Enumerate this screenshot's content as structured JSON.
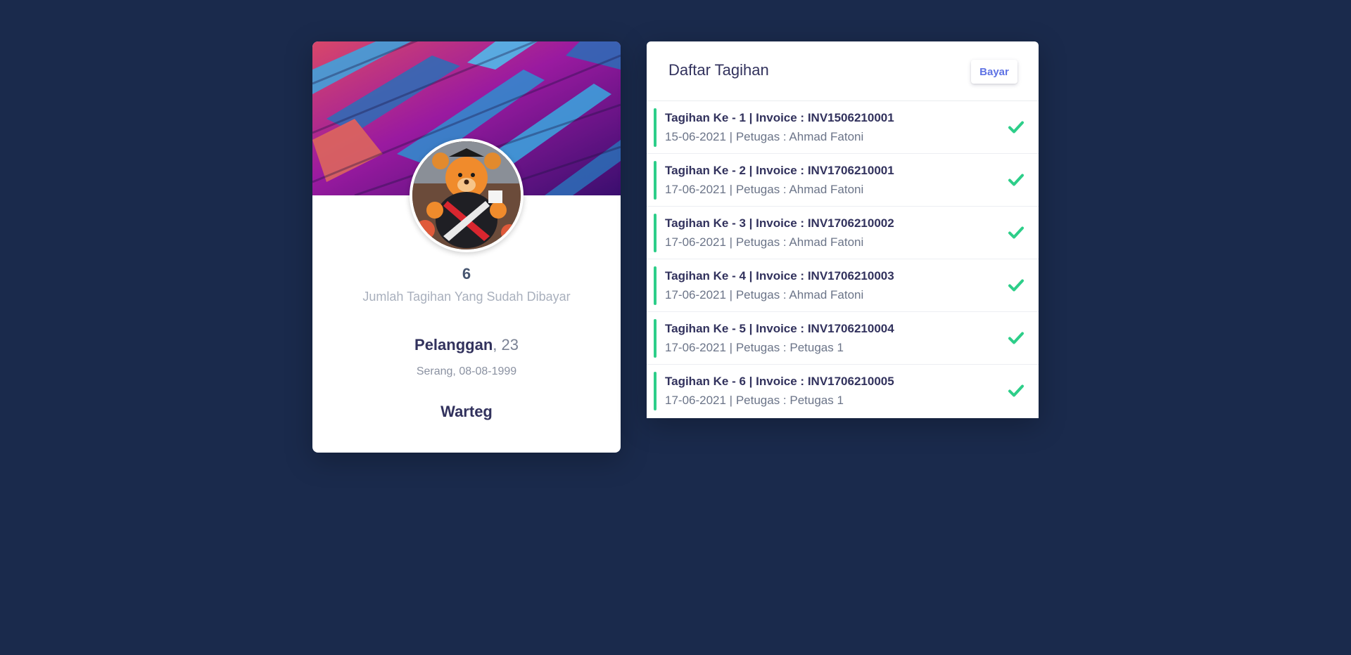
{
  "profile": {
    "paid_count": "6",
    "paid_label": "Jumlah Tagihan Yang Sudah Dibayar",
    "name": "Pelanggan",
    "age": ", 23",
    "birth": "Serang, 08-08-1999",
    "occupation": "Warteg",
    "cover_icon": "building-facade-image",
    "avatar_icon": "teddy-bear-graduate-avatar"
  },
  "invoices": {
    "title": "Daftar Tagihan",
    "pay_label": "Bayar",
    "accent_color": "#2dce89",
    "items": [
      {
        "title": "Tagihan Ke - 1 | Invoice : INV1506210001",
        "sub": "15-06-2021 | Petugas : Ahmad Fatoni"
      },
      {
        "title": "Tagihan Ke - 2 | Invoice : INV1706210001",
        "sub": "17-06-2021 | Petugas : Ahmad Fatoni"
      },
      {
        "title": "Tagihan Ke - 3 | Invoice : INV1706210002",
        "sub": "17-06-2021 | Petugas : Ahmad Fatoni"
      },
      {
        "title": "Tagihan Ke - 4 | Invoice : INV1706210003",
        "sub": "17-06-2021 | Petugas : Ahmad Fatoni"
      },
      {
        "title": "Tagihan Ke - 5 | Invoice : INV1706210004",
        "sub": "17-06-2021 | Petugas : Petugas 1"
      },
      {
        "title": "Tagihan Ke - 6 | Invoice : INV1706210005",
        "sub": "17-06-2021 | Petugas : Petugas 1"
      }
    ]
  }
}
